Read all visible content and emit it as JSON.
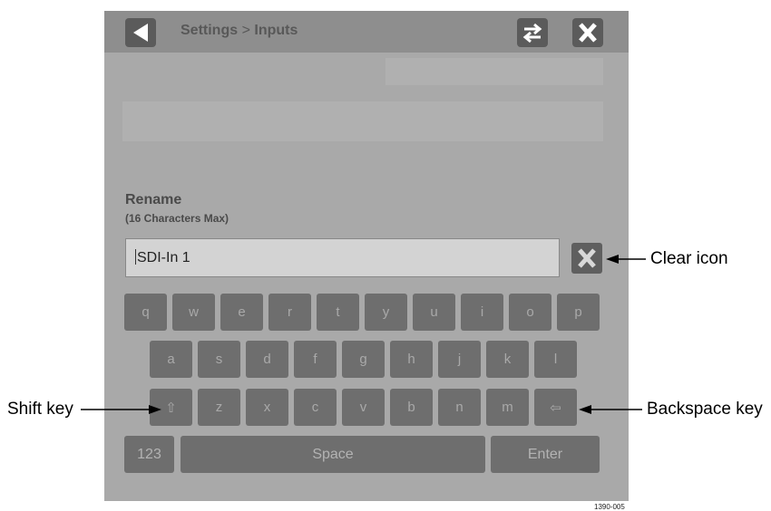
{
  "header": {
    "back_icon": "back-arrow-icon",
    "breadcrumb_settings": "Settings",
    "breadcrumb_separator": ">",
    "breadcrumb_inputs": "Inputs",
    "swap_icon": "swap-arrows-icon",
    "close_icon": "close-x-icon"
  },
  "dialog": {
    "title": "Rename",
    "subtitle": "(16 Characters Max)",
    "input_value": "SDI-In 1",
    "clear_icon": "clear-x-icon"
  },
  "keyboard": {
    "row1": [
      "q",
      "w",
      "e",
      "r",
      "t",
      "y",
      "u",
      "i",
      "o",
      "p"
    ],
    "row2": [
      "a",
      "s",
      "d",
      "f",
      "g",
      "h",
      "j",
      "k",
      "l"
    ],
    "row3": [
      "z",
      "x",
      "c",
      "v",
      "b",
      "n",
      "m"
    ],
    "shift_key": "⇧",
    "backspace_key": "⇦",
    "numbers_key": "123",
    "space_key": "Space",
    "enter_key": "Enter"
  },
  "annotations": {
    "clear_icon": "Clear icon",
    "shift_key": "Shift key",
    "backspace_key": "Backspace key"
  },
  "figure_number": "1390-005"
}
